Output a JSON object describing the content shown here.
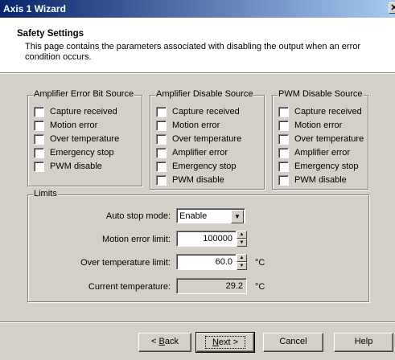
{
  "window": {
    "title": "Axis 1 Wizard",
    "close_glyph": "✕"
  },
  "header": {
    "title": "Safety Settings",
    "description": "This page contains the parameters associated with disabling the output when an error condition occurs."
  },
  "groups": {
    "amp_error": {
      "label": "Amplifier Error Bit Source",
      "items": [
        "Capture received",
        "Motion error",
        "Over temperature",
        "Emergency stop",
        "PWM disable"
      ]
    },
    "amp_disable": {
      "label": "Amplifier Disable Source",
      "items": [
        "Capture received",
        "Motion error",
        "Over temperature",
        "Amplifier error",
        "Emergency stop",
        "PWM disable"
      ]
    },
    "pwm_disable": {
      "label": "PWM Disable Source",
      "items": [
        "Capture received",
        "Motion error",
        "Over temperature",
        "Amplifier error",
        "Emergency stop",
        "PWM disable"
      ]
    }
  },
  "limits": {
    "label": "Limits",
    "auto_stop_label": "Auto stop mode:",
    "auto_stop_value": "Enable",
    "motion_error_label": "Motion error limit:",
    "motion_error_value": "100000",
    "over_temp_label": "Over temperature limit:",
    "over_temp_value": "60.0",
    "over_temp_unit": "°C",
    "current_temp_label": "Current temperature:",
    "current_temp_value": "29.2",
    "current_temp_unit": "°C"
  },
  "buttons": {
    "back_prefix": "< ",
    "back_mnemonic": "B",
    "back_rest": "ack",
    "next_mnemonic": "N",
    "next_rest": "ext >",
    "cancel": "Cancel",
    "help": "Help"
  },
  "checkbox_states": {
    "all_checked": false
  }
}
